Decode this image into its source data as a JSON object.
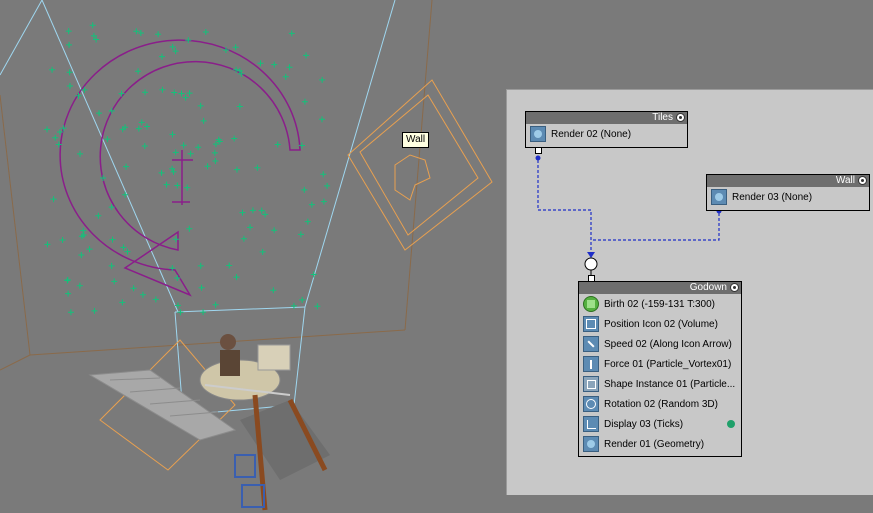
{
  "viewport": {
    "tooltip": "Wall",
    "colors": {
      "background": "#7a7a7a",
      "frustum": "#9fd7f0",
      "vortex": "#8a1e8a",
      "particles": "#12c27a",
      "deflector": "#e8a050"
    }
  },
  "particle_view": {
    "nodes": [
      {
        "title": "Tiles",
        "operators": [
          {
            "icon": "render-icon",
            "label": "Render 02 (None)"
          }
        ]
      },
      {
        "title": "Wall",
        "operators": [
          {
            "icon": "render-icon",
            "label": "Render 03 (None)"
          }
        ]
      },
      {
        "title": "Godown",
        "operators": [
          {
            "icon": "birth-icon",
            "label": "Birth 02 (-159-131 T:300)"
          },
          {
            "icon": "position-icon",
            "label": "Position Icon 02 (Volume)"
          },
          {
            "icon": "speed-icon",
            "label": "Speed 02 (Along Icon Arrow)"
          },
          {
            "icon": "force-icon",
            "label": "Force 01 (Particle_Vortex01)"
          },
          {
            "icon": "shape-instance-icon",
            "label": "Shape Instance 01 (Particle..."
          },
          {
            "icon": "rotation-icon",
            "label": "Rotation 02 (Random 3D)"
          },
          {
            "icon": "display-icon",
            "label": "Display 03 (Ticks)"
          },
          {
            "icon": "render-icon",
            "label": "Render 01 (Geometry)"
          }
        ]
      }
    ]
  }
}
